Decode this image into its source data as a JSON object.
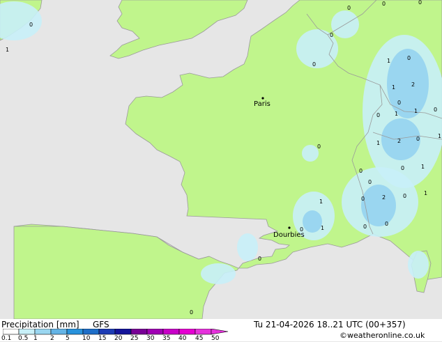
{
  "map": {
    "colors": {
      "sea": "#e6e6e6",
      "land": "#c0f58c",
      "border": "#9a9a9a",
      "coast": "#9a9a9a",
      "precip_light": "#c8f0f8",
      "precip_mid": "#9ad6f0",
      "precip_strong": "#64b4e6"
    },
    "cities": [
      {
        "name": "Paris"
      },
      {
        "name": "Dourbies"
      }
    ],
    "values": [
      "0",
      "0",
      "0",
      "0",
      "1",
      "0",
      "0",
      "0",
      "1",
      "0",
      "1",
      "2",
      "0",
      "1",
      "1",
      "0",
      "1",
      "2",
      "0",
      "1",
      "0",
      "0",
      "1",
      "0",
      "0",
      "1",
      "0",
      "2",
      "0",
      "1",
      "0",
      "0",
      "1",
      "0",
      "0",
      "0"
    ]
  },
  "footer": {
    "title": "Precipitation [mm]",
    "model": "GFS",
    "datetime": "Tu 21-04-2026 18..21 UTC (00+357)",
    "credit": "©weatheronline.co.uk",
    "scale_labels": [
      "0.1",
      "0.5",
      "1",
      "2",
      "5",
      "10",
      "15",
      "20",
      "25",
      "30",
      "35",
      "40",
      "45",
      "50"
    ],
    "scale_colors": [
      "#ffffff",
      "#c8f0f8",
      "#9ad6f0",
      "#64b4e6",
      "#2892dc",
      "#1e6ec8",
      "#1e3cb4",
      "#14149a",
      "#780096",
      "#a000b4",
      "#c800c8",
      "#e600d2",
      "#e632dc"
    ]
  }
}
